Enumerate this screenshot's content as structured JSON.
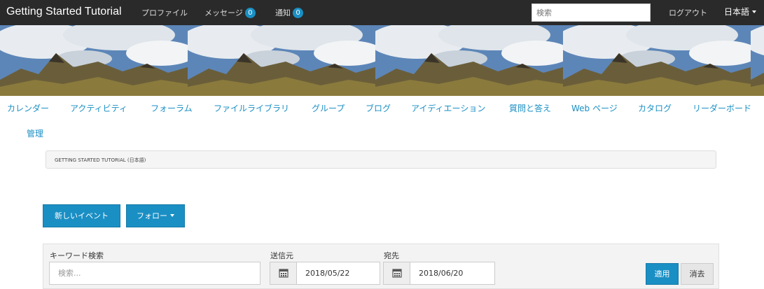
{
  "header": {
    "brand": "Getting Started Tutorial",
    "nav": {
      "profile": "プロファイル",
      "messages": "メッセージ",
      "messages_count": "0",
      "notifications": "通知",
      "notifications_count": "0",
      "logout": "ログアウト",
      "language": "日本語"
    },
    "search_placeholder": "検索"
  },
  "main_nav": {
    "items": [
      "カレンダー",
      "アクティビティ",
      "フォーラム",
      "ファイルライブラリ",
      "グループ",
      "ブログ",
      "アイディエーション",
      "質問と答え",
      "Web ページ",
      "カタログ",
      "リーダーボード",
      "管理"
    ]
  },
  "breadcrumb": {
    "text": "GETTING STARTED TUTORIAL (日本語)"
  },
  "actions": {
    "new_event": "新しいイベント",
    "follow": "フォロー"
  },
  "filter": {
    "keyword_label": "キーワード検索",
    "keyword_placeholder": "検索...",
    "from_label": "送信元",
    "from_value": "2018/05/22",
    "to_label": "宛先",
    "to_value": "2018/06/20",
    "apply": "適用",
    "clear": "消去"
  },
  "colors": {
    "accent": "#1a8fc4",
    "topbar": "#2a2a2a"
  }
}
